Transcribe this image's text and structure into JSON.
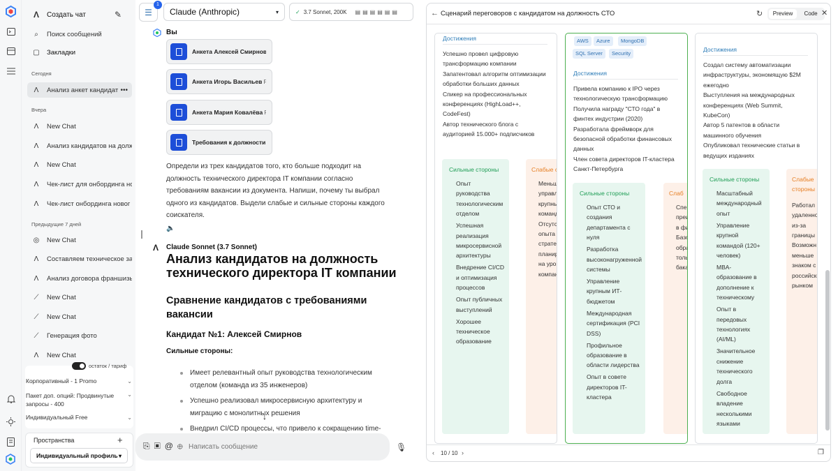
{
  "sidebar": {
    "new_chat": "Создать чат",
    "search": "Поиск сообщений",
    "bookmarks": "Закладки",
    "groups": [
      {
        "title": "Сегодня",
        "items": [
          "Анализ анкет кандидат"
        ]
      },
      {
        "title": "Вчера",
        "items": [
          "New Chat",
          "Анализ кандидатов на долж",
          "New Chat",
          "Чек-лист для онбординга но",
          "Чек-лист онбординга новог"
        ]
      },
      {
        "title": "Предыдущие 7 дней",
        "items": [
          "New Chat",
          "Составляем техническое за",
          "Анализ договора франшизы",
          "New Chat",
          "New Chat",
          "Генерация фото",
          "New Chat"
        ]
      }
    ],
    "balance_toggle_label": "остаток / тариф",
    "plans": [
      "Корпоративный - 1 Promo",
      "Пакет доп. опций: Продвинутые запросы - 400",
      "Индивидуальный Free"
    ],
    "spaces_label": "Пространства",
    "profile": "Индивидуальный профиль"
  },
  "topbar": {
    "badge": "1",
    "model": "Claude (Anthropic)",
    "model_version": "3.7 Sonnet, 200K"
  },
  "chat": {
    "user_label": "Вы",
    "files": [
      {
        "name": "Анкета Алексей Смирнов",
        "ext": "F"
      },
      {
        "name": "Анкета Игорь Васильев",
        "ext": "F"
      },
      {
        "name": "Анкета Мария Ковалёва",
        "ext": "F"
      },
      {
        "name": "Требования к должности",
        "ext": "F"
      }
    ],
    "user_message": "Определи из трех кандидатов того, кто больше подходит на должность технического директора IT компании согласно требованиям вакансии из документа. Напиши, почему ты выбрал одного из кандидатов. Выдели слабые и сильные стороны каждого соискателя.",
    "assistant_label": "Claude Sonnet (3.7 Sonnet)",
    "h1": "Анализ кандидатов на должность технического директора IT компании",
    "h2": "Сравнение кандидатов с требованиями вакансии",
    "h3": "Кандидат №1: Алексей Смирнов",
    "strengths_label": "Сильные стороны:",
    "bullets": [
      "Имеет релевантный опыт руководства технологическим отделом (команда из 35 инженеров)",
      "Успешно реализовал микросервисную архитектуру и миграцию с монолитных решения",
      "Внедрил CI/CD процессы, что привело к сокращению time-"
    ],
    "input_placeholder": "Написать сообщение"
  },
  "panel": {
    "title": "Сценарий переговоров с кандидатом на должность СТО",
    "tab_preview": "Preview",
    "tab_code": "Code",
    "page": "10 / 10",
    "achievements_label": "Достижения",
    "strong_label": "Сильные стороны",
    "weak_label": "Слабые стороны",
    "card1": {
      "achievements": [
        "Успешно провел цифровую трансформацию компании",
        "Запатентовал алгоритм оптимизации обработки больших данных",
        "Спикер на профессиональных конференциях (HighLoad++, CodeFest)",
        "Автор технического блога с аудиторией 15.000+ подписчиков"
      ],
      "strong": [
        "Опыт руководства технологическим отделом",
        "Успешная реализация микросервисной архитектуры",
        "Внедрение CI/CD и оптимизация процессов",
        "Опыт публичных выступлений",
        "Хорошее техническое образование"
      ],
      "weak": [
        "Меньший",
        "управле",
        "крупным",
        "команда",
        "Отсутств",
        "опыта",
        "стратеги",
        "планиро",
        "на уровн",
        "компани"
      ]
    },
    "card2": {
      "tags": [
        "AWS",
        "Azure",
        "MongoDB",
        "SQL Server",
        "Security"
      ],
      "achievements": [
        "Привела компанию к IPO через технологическую трансформацию",
        "Получила награду \"СТО года\" в финтех индустрии (2020)",
        "Разработала фреймворк для безопасной обработки финансовых данных",
        "Член совета директоров IT-кластера Санкт-Петербурга"
      ],
      "strong": [
        "Опыт СТО и создания департамента с нуля",
        "Разработка высоконагруженной системы",
        "Управление крупным ИТ-бюджетом",
        "Международная сертификация (PCI DSS)",
        "Профильное образование в области лидерства",
        "Опыт в совете директоров IT-кластера"
      ],
      "weak": [
        "Слаб",
        "Спец",
        "преи",
        "в фи",
        "Базо",
        "обра",
        "толь",
        "бака"
      ]
    },
    "card3": {
      "achievements": [
        "Создал систему автоматизации инфраструктуры, экономящую $2M ежегодно",
        "Выступления на международных конференциях (Web Summit, KubeCon)",
        "Автор 5 патентов в области машинного обучения",
        "Опубликовал технические статьи в ведущих изданиях"
      ],
      "strong": [
        "Масштабный международный опыт",
        "Управление крупной командой (120+ человек)",
        "MBA-образование в дополнение к техническому",
        "Опыт в передовых технологиях (AI/ML)",
        "Значительное снижение технического долга",
        "Свободное владение несколькими языками"
      ],
      "weak": [
        "Слабые",
        "стороны",
        "Работал",
        "удаленно",
        "из-за",
        "границы",
        "Возможн",
        "меньше",
        "знаком с",
        "российск",
        "рынком"
      ]
    }
  },
  "colors": {
    "accent": "#1d4ed8",
    "strong_bg": "#e7f6ef",
    "weak_bg": "#fdf0e8",
    "selected_card": "#4caf50",
    "section_blue": "#2e7db8"
  }
}
